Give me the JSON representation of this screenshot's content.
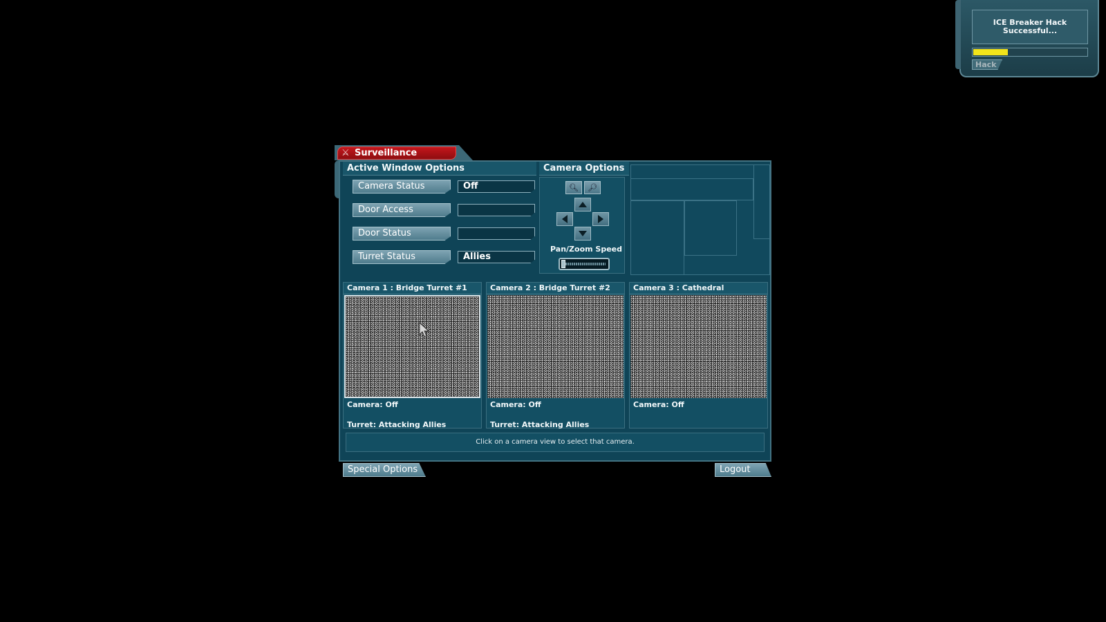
{
  "hack_widget": {
    "message": "ICE Breaker Hack Successful...",
    "progress": 0.3,
    "progress_color": "#f2e41a",
    "button_label": "Hack"
  },
  "window": {
    "title": "Surveillance",
    "title_color": "#c4161c"
  },
  "active_window_options": {
    "heading": "Active Window Options",
    "rows": [
      {
        "label": "Camera Status",
        "value": "Off"
      },
      {
        "label": "Door Access",
        "value": ""
      },
      {
        "label": "Door Status",
        "value": ""
      },
      {
        "label": "Turret Status",
        "value": "Allies"
      }
    ]
  },
  "camera_options": {
    "heading": "Camera Options",
    "zoom_in_icon": "zoom-in-icon",
    "zoom_out_icon": "zoom-out-icon",
    "speed_label": "Pan/Zoom Speed",
    "speed_value": 0
  },
  "cameras": [
    {
      "title": "Camera 1 : Bridge Turret #1",
      "camera_status": "Camera: Off",
      "turret_status": "Turret: Attacking Allies",
      "selected": true
    },
    {
      "title": "Camera 2 : Bridge Turret #2",
      "camera_status": "Camera: Off",
      "turret_status": "Turret: Attacking Allies",
      "selected": false
    },
    {
      "title": "Camera 3 : Cathedral",
      "camera_status": "Camera: Off",
      "turret_status": "",
      "selected": false
    }
  ],
  "status_message": "Click on a camera view to select that camera.",
  "footer": {
    "special_options": "Special Options",
    "logout": "Logout"
  }
}
